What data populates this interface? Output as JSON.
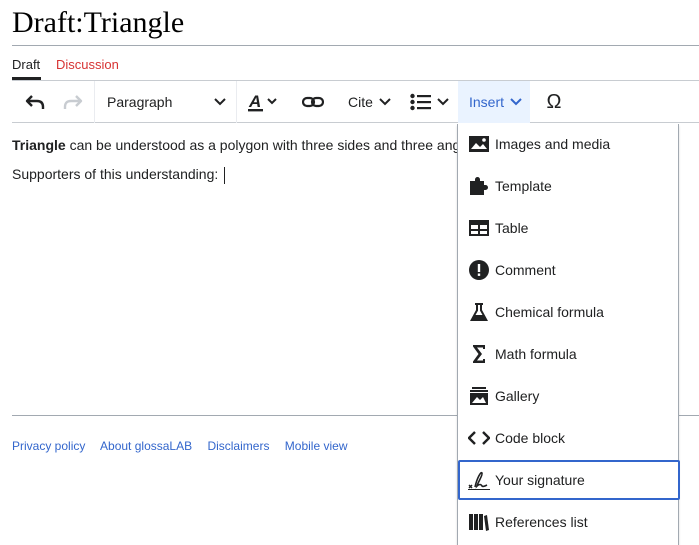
{
  "page": {
    "title": "Draft:Triangle"
  },
  "tabs": [
    {
      "label": "Draft"
    },
    {
      "label": "Discussion"
    }
  ],
  "toolbar": {
    "paragraph_label": "Paragraph",
    "cite_label": "Cite",
    "insert_label": "Insert",
    "special_char_symbol": "Ω"
  },
  "content": {
    "bold_term": "Triangle",
    "line1_rest": " can be understood as a polygon with three sides and three ang",
    "line2": "Supporters of this understanding:"
  },
  "insert_menu": {
    "items": [
      {
        "label": "Images and media",
        "icon": "image-icon"
      },
      {
        "label": "Template",
        "icon": "puzzle-icon"
      },
      {
        "label": "Table",
        "icon": "table-icon"
      },
      {
        "label": "Comment",
        "icon": "comment-icon"
      },
      {
        "label": "Chemical formula",
        "icon": "flask-icon"
      },
      {
        "label": "Math formula",
        "icon": "sigma-icon"
      },
      {
        "label": "Gallery",
        "icon": "gallery-icon"
      },
      {
        "label": "Code block",
        "icon": "code-icon"
      },
      {
        "label": "Your signature",
        "icon": "signature-icon"
      },
      {
        "label": "References list",
        "icon": "references-icon"
      }
    ],
    "focused_item": "Your signature"
  },
  "footer": {
    "links": [
      "Privacy policy",
      "About glossaLAB",
      "Disclaimers",
      "Mobile view"
    ]
  },
  "colors": {
    "link": "#3366cc",
    "discussion_red": "#d73333",
    "insert_bg": "#eaf3ff",
    "text": "#202122"
  }
}
